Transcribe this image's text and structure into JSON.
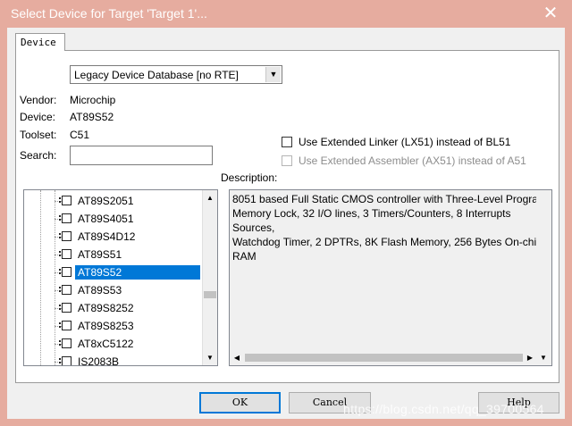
{
  "window": {
    "title": "Select Device for Target 'Target 1'...",
    "close_glyph": "✕",
    "titlebar_color": "#e6ac9f"
  },
  "tabs": [
    {
      "label": "Device"
    }
  ],
  "database_select": {
    "value": "Legacy Device Database [no RTE]"
  },
  "info": {
    "vendor_label": "Vendor:",
    "vendor_value": "Microchip",
    "device_label": "Device:",
    "device_value": "AT89S52",
    "toolset_label": "Toolset:",
    "toolset_value": "C51",
    "search_label": "Search:",
    "search_value": ""
  },
  "options": {
    "extended_linker": {
      "label": "Use Extended Linker (LX51) instead of BL51",
      "checked": false,
      "enabled": true
    },
    "extended_assembler": {
      "label": "Use Extended Assembler (AX51) instead of A51",
      "checked": false,
      "enabled": false
    }
  },
  "description": {
    "label": "Description:",
    "text": "8051 based Full Static CMOS controller with Three-Level Program\nMemory Lock, 32 I/O lines, 3 Timers/Counters, 8 Interrupts Sources,\nWatchdog Timer, 2 DPTRs, 8K Flash Memory, 256 Bytes On-chip RAM"
  },
  "device_tree": {
    "items": [
      {
        "label": "AT89S2051",
        "selected": false
      },
      {
        "label": "AT89S4051",
        "selected": false
      },
      {
        "label": "AT89S4D12",
        "selected": false
      },
      {
        "label": "AT89S51",
        "selected": false
      },
      {
        "label": "AT89S52",
        "selected": true
      },
      {
        "label": "AT89S53",
        "selected": false
      },
      {
        "label": "AT89S8252",
        "selected": false
      },
      {
        "label": "AT89S8253",
        "selected": false
      },
      {
        "label": "AT8xC5122",
        "selected": false
      },
      {
        "label": "IS2083B",
        "selected": false
      }
    ]
  },
  "buttons": {
    "ok": "OK",
    "cancel": "Cancel",
    "help": "Help"
  },
  "watermark": "https://blog.csdn.net/qq_39700564",
  "colors": {
    "selection": "#0078d7",
    "accent": "#0078d7"
  }
}
